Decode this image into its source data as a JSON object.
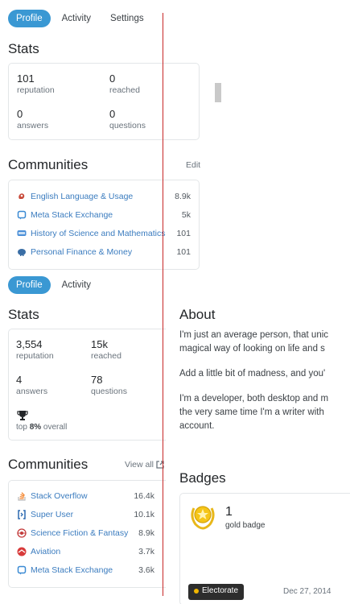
{
  "top": {
    "tabs": [
      {
        "label": "Profile",
        "active": true
      },
      {
        "label": "Activity",
        "active": false
      },
      {
        "label": "Settings",
        "active": false
      }
    ],
    "stats_title": "Stats",
    "stats": [
      {
        "value": "101",
        "label": "reputation"
      },
      {
        "value": "0",
        "label": "reached"
      },
      {
        "value": "0",
        "label": "answers"
      },
      {
        "value": "0",
        "label": "questions"
      }
    ],
    "communities_title": "Communities",
    "edit_label": "Edit",
    "communities": [
      {
        "name": "English Language & Usage",
        "rep": "8.9k",
        "icon": "ell-icon",
        "color": "#c84a3a"
      },
      {
        "name": "Meta Stack Exchange",
        "rep": "5k",
        "icon": "meta-se-icon",
        "color": "#3a8ad3"
      },
      {
        "name": "History of Science and Mathematics",
        "rep": "101",
        "icon": "hsm-icon",
        "color": "#4a8fd8"
      },
      {
        "name": "Personal Finance & Money",
        "rep": "101",
        "icon": "money-icon",
        "color": "#3a6ea5"
      }
    ]
  },
  "bottom": {
    "tabs": [
      {
        "label": "Profile",
        "active": true
      },
      {
        "label": "Activity",
        "active": false
      }
    ],
    "stats_title": "Stats",
    "stats": [
      {
        "value": "3,554",
        "label": "reputation"
      },
      {
        "value": "15k",
        "label": "reached"
      },
      {
        "value": "4",
        "label": "answers"
      },
      {
        "value": "78",
        "label": "questions"
      }
    ],
    "top_prefix": "top ",
    "top_percent": "8%",
    "top_suffix": " overall",
    "communities_title": "Communities",
    "view_all_label": "View all",
    "communities": [
      {
        "name": "Stack Overflow",
        "rep": "16.4k",
        "icon": "stackoverflow-icon",
        "color": "#f48024"
      },
      {
        "name": "Super User",
        "rep": "10.1k",
        "icon": "superuser-icon",
        "color": "#2d6ab1"
      },
      {
        "name": "Science Fiction & Fantasy",
        "rep": "8.9k",
        "icon": "scifi-icon",
        "color": "#c33b3b"
      },
      {
        "name": "Aviation",
        "rep": "3.7k",
        "icon": "aviation-icon",
        "color": "#d83b3b"
      },
      {
        "name": "Meta Stack Exchange",
        "rep": "3.6k",
        "icon": "meta-se-icon",
        "color": "#3a8ad3"
      }
    ],
    "about_title": "About",
    "about_lines": [
      "I'm just an average person, that unic",
      "magical way of looking on life and s",
      "Add a little bit of madness, and you'",
      "I'm a developer, both desktop and m",
      "the very same time I'm a writer with",
      "account."
    ],
    "badges_title": "Badges",
    "badge": {
      "count": "1",
      "kind": "gold badge",
      "chip": "Electorate",
      "date": "Dec 27, 2014"
    }
  }
}
